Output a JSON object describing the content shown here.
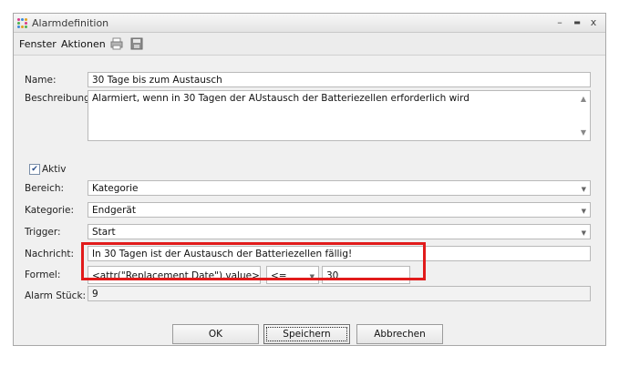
{
  "window": {
    "title": "Alarmdefinition",
    "minimize_glyph": "–",
    "maximize_glyph": "▬",
    "close_glyph": "x"
  },
  "menu": {
    "items": [
      "Fenster",
      "Aktionen"
    ],
    "tools": [
      "print-icon",
      "save-icon"
    ]
  },
  "form": {
    "name_label": "Name:",
    "name_value": "30 Tage bis zum Austausch",
    "description_label": "Beschreibung:",
    "description_value": "Alarmiert, wenn in 30 Tagen der AUstausch der Batteriezellen erforderlich wird",
    "active_label": "Aktiv",
    "active_checked": true,
    "area_label": "Bereich:",
    "area_value": "Kategorie",
    "category_label": "Kategorie:",
    "category_value": "Endgerät",
    "trigger_label": "Trigger:",
    "trigger_value": "Start",
    "message_label": "Nachricht:",
    "message_value": "In 30 Tagen ist der Austausch der Batteriezellen fällig!",
    "formula_label": "Formel:",
    "formula_expression": "<attr(\"Replacement Date\").value>",
    "formula_operator": "<=",
    "formula_value": "30",
    "alarm_count_label": "Alarm Stück:",
    "alarm_count_value": "9"
  },
  "buttons": {
    "ok": "OK",
    "save": "Speichern",
    "cancel": "Abbrechen"
  },
  "colors": {
    "highlight": "#e11b1b",
    "window_bg": "#f0f0f0"
  }
}
